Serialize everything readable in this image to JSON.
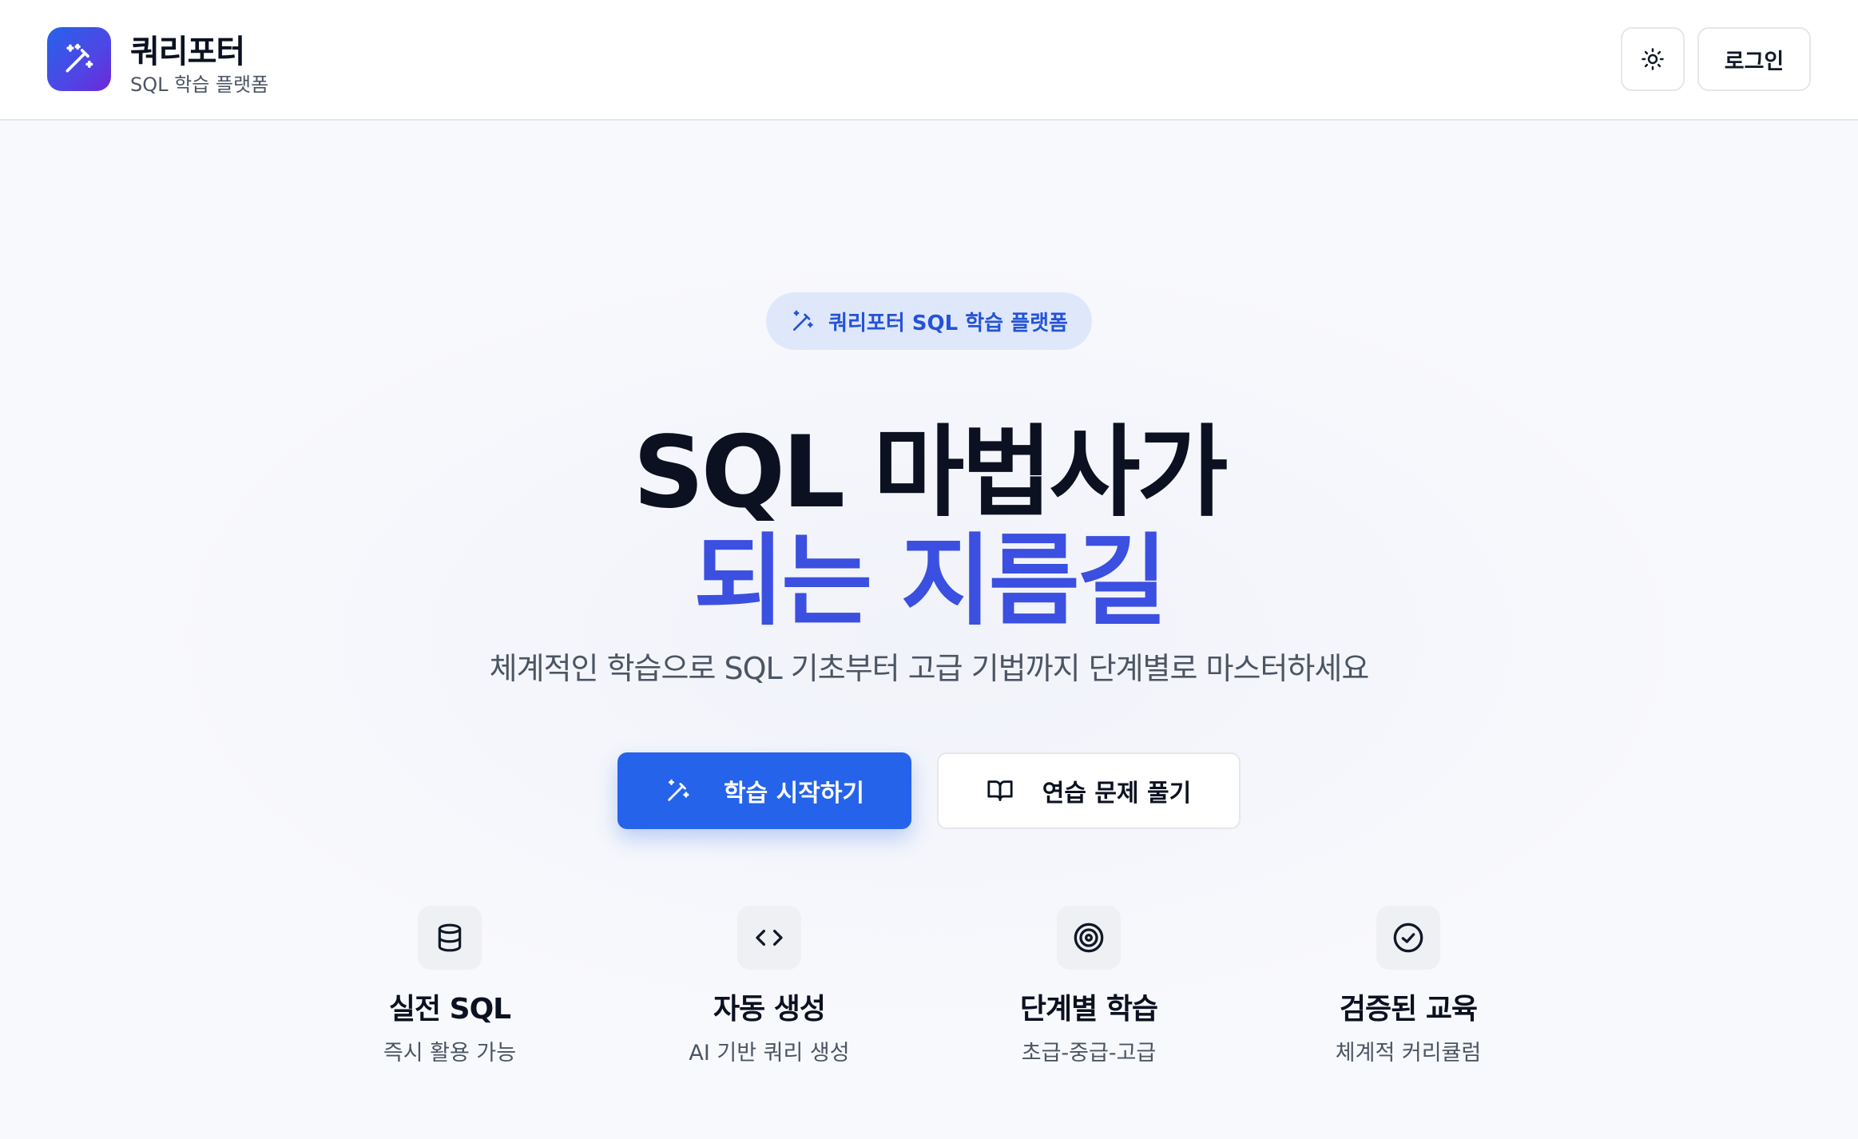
{
  "header": {
    "brand_name": "쿼리포터",
    "brand_sub": "SQL 학습 플랫폼",
    "logo_icon": "magic-wand-icon",
    "theme_icon": "sun-icon",
    "login_label": "로그인"
  },
  "hero": {
    "badge_label": "쿼리포터 SQL 학습 플랫폼",
    "headline_line1": "SQL 마법사가",
    "headline_line2": "되는 지름길",
    "subtitle": "체계적인 학습으로 SQL 기초부터 고급 기법까지 단계별로 마스터하세요",
    "primary_cta": "학습 시작하기",
    "secondary_cta": "연습 문제 풀기"
  },
  "features": [
    {
      "icon": "database-icon",
      "title": "실전 SQL",
      "subtitle": "즉시 활용 가능"
    },
    {
      "icon": "code-icon",
      "title": "자동 생성",
      "subtitle": "AI 기반 쿼리 생성"
    },
    {
      "icon": "target-icon",
      "title": "단계별 학습",
      "subtitle": "초급-중급-고급"
    },
    {
      "icon": "check-circle-icon",
      "title": "검증된 교육",
      "subtitle": "체계적 커리큘럼"
    }
  ],
  "colors": {
    "primary": "#2563eb",
    "headline_accent": "#3b4fe0",
    "badge_bg": "#dfe7fb",
    "badge_text": "#2453d6"
  }
}
